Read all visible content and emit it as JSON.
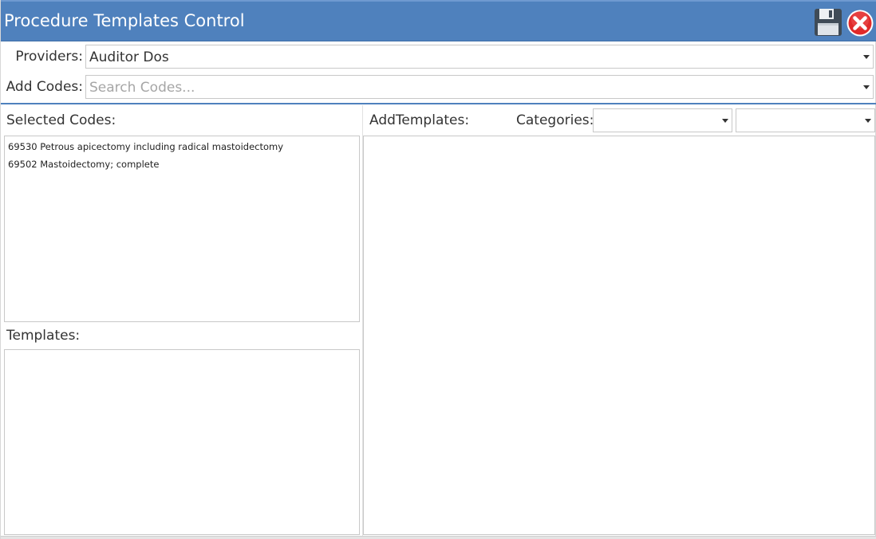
{
  "window": {
    "title": "Procedure Templates Control"
  },
  "toolbar": {
    "save_icon": "floppy-disk-icon",
    "close_icon": "close-circle-icon",
    "close_color": "#e02a2a"
  },
  "providers": {
    "label": "Providers:",
    "value": "Auditor Dos"
  },
  "add_codes": {
    "label": "Add Codes:",
    "placeholder": "Search Codes..."
  },
  "selected_codes": {
    "label": "Selected Codes:",
    "items": [
      "69530 Petrous apicectomy including radical mastoidectomy",
      "69502 Mastoidectomy; complete"
    ]
  },
  "templates": {
    "label": "Templates:"
  },
  "add_templates": {
    "label": "AddTemplates:",
    "categories_label": "Categories:",
    "category_value": "",
    "subcategory_value": ""
  },
  "colors": {
    "titlebar": "#4f81bd",
    "accent": "#4f81bd"
  }
}
